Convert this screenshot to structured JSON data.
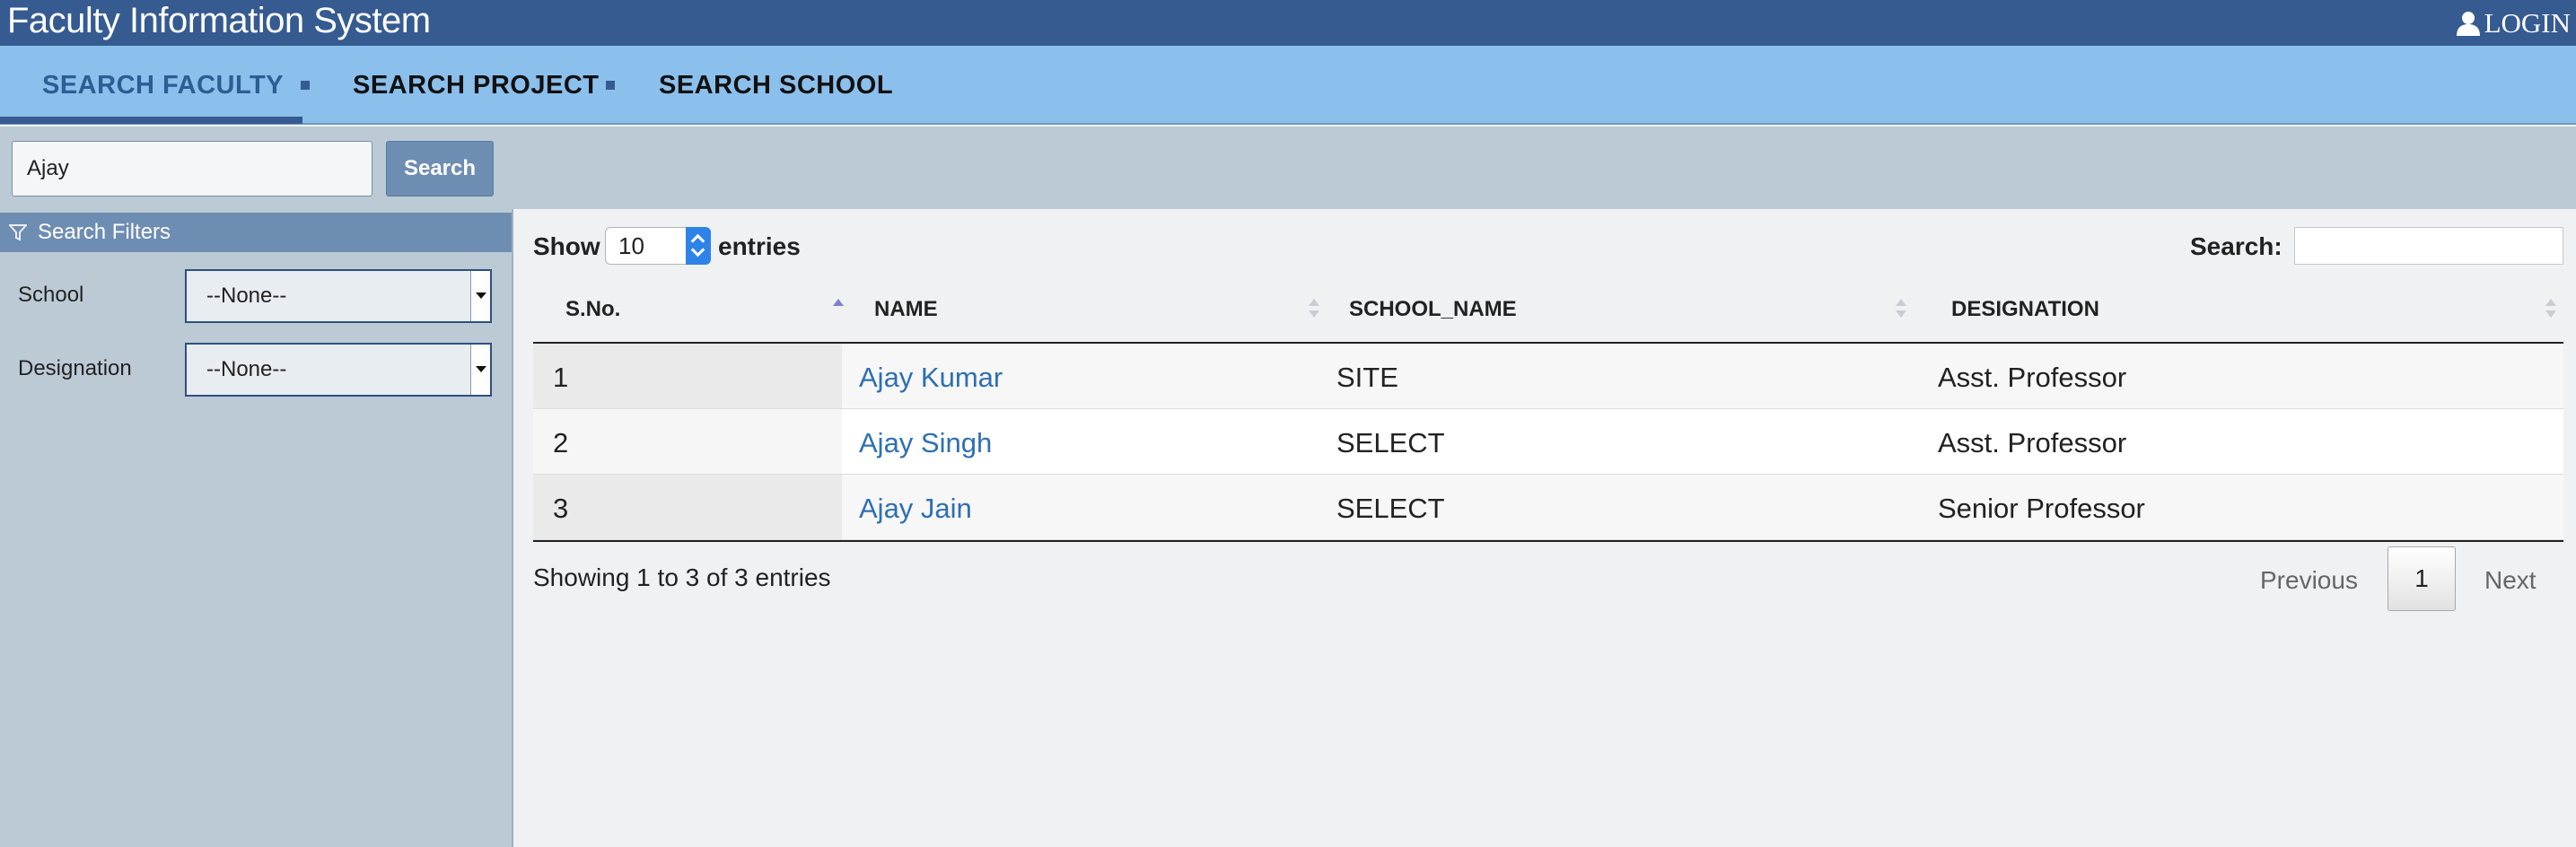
{
  "header": {
    "app_title": "Faculty Information System",
    "login_label": "LOGIN"
  },
  "nav": {
    "tabs": [
      {
        "label": "SEARCH FACULTY",
        "active": true
      },
      {
        "label": "SEARCH PROJECT",
        "active": false
      },
      {
        "label": "SEARCH SCHOOL",
        "active": false
      }
    ]
  },
  "search": {
    "value": "Ajay",
    "button_label": "Search"
  },
  "filters": {
    "title": "Search Filters",
    "school": {
      "label": "School",
      "selected": "--None--"
    },
    "designation": {
      "label": "Designation",
      "selected": "--None--"
    }
  },
  "table": {
    "show_label": "Show",
    "page_length": "10",
    "entries_label": "entries",
    "search_label": "Search:",
    "columns": [
      "S.No.",
      "NAME",
      "SCHOOL_NAME",
      "DESIGNATION"
    ],
    "rows": [
      {
        "sno": "1",
        "name": "Ajay Kumar",
        "school": "SITE",
        "designation": "Asst. Professor"
      },
      {
        "sno": "2",
        "name": "Ajay Singh",
        "school": "SELECT",
        "designation": "Asst. Professor"
      },
      {
        "sno": "3",
        "name": "Ajay Jain",
        "school": "SELECT",
        "designation": "Senior Professor"
      }
    ],
    "info": "Showing 1 to 3 of 3 entries",
    "pagination": {
      "previous": "Previous",
      "current": "1",
      "next": "Next"
    }
  },
  "colors": {
    "header_bg": "#355b91",
    "nav_bg": "#8bbfec",
    "panel_bg": "#bccad5",
    "accent": "#6e8db2",
    "link": "#2e6fb3"
  }
}
